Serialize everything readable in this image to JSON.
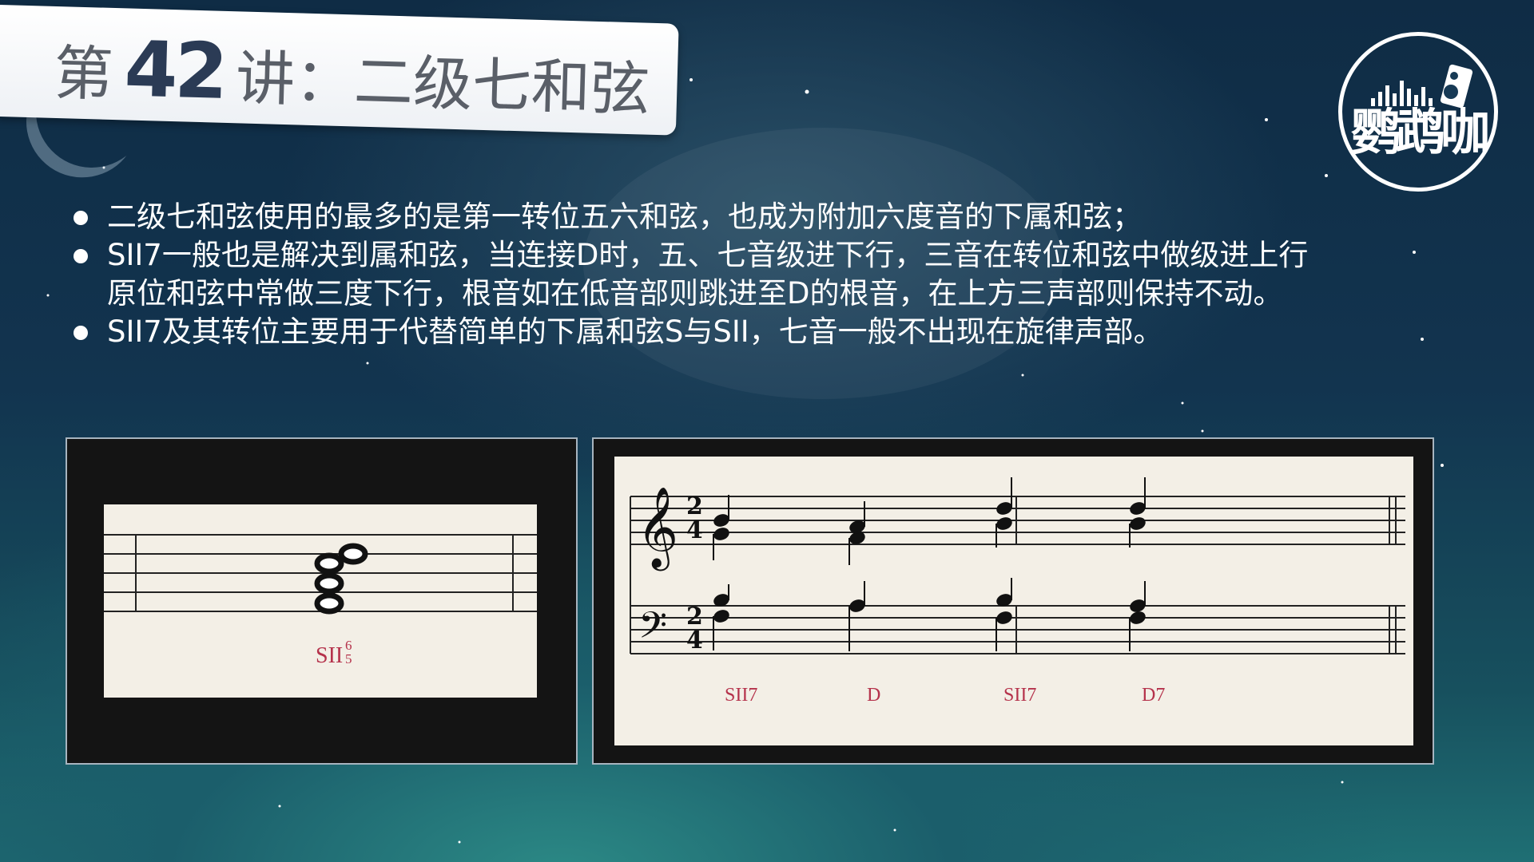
{
  "title": {
    "prefix": "第",
    "number": "42",
    "suffix": "讲：二级七和弦"
  },
  "logo": {
    "text": "鹦鹉咖"
  },
  "bullets": [
    {
      "lines": [
        "二级七和弦使用的最多的是第一转位五六和弦，也成为附加六度音的下属和弦；"
      ]
    },
    {
      "lines": [
        "SII7一般也是解决到属和弦，当连接D时，五、七音级进下行，三音在转位和弦中做级进上行",
        "原位和弦中常做三度下行，根音如在低音部则跳进至D的根音，在上方三声部则保持不动。"
      ]
    },
    {
      "lines": [
        "SII7及其转位主要用于代替简单的下属和弦S与SII，七音一般不出现在旋律声部。"
      ]
    }
  ],
  "left_example": {
    "chord_label": "SII",
    "figure_top": "6",
    "figure_bottom": "5"
  },
  "right_example": {
    "time_signature": {
      "top": "2",
      "bottom": "4"
    },
    "chord_labels": [
      "SII7",
      "D",
      "SII7",
      "D7"
    ]
  },
  "colors": {
    "label": "#b5324b",
    "text": "#ffffff",
    "paper": "#f3efe6"
  }
}
